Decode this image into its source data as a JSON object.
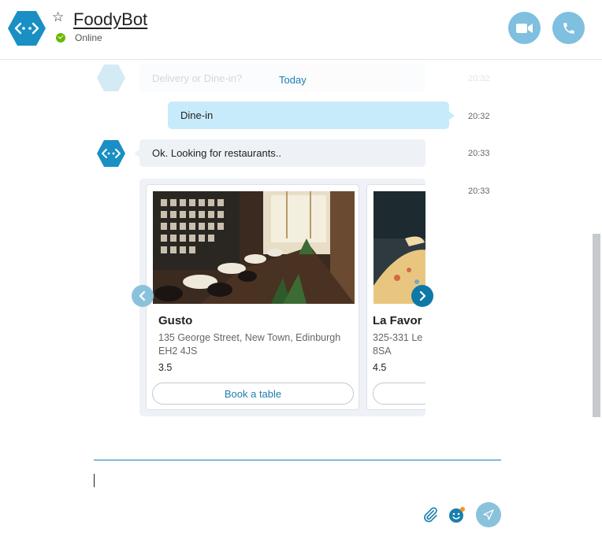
{
  "header": {
    "title": "FoodyBot",
    "status": "Online"
  },
  "chat": {
    "date_separator": "Today",
    "messages": [
      {
        "from": "bot",
        "text": "Delivery or Dine-in?",
        "time": "20:32"
      },
      {
        "from": "me",
        "text": "Dine-in",
        "time": "20:32"
      },
      {
        "from": "bot",
        "text": "Ok. Looking for restaurants..",
        "time": "20:33"
      },
      {
        "from": "bot",
        "type": "carousel",
        "time": "20:33"
      }
    ],
    "carousel": {
      "cards": [
        {
          "name": "Gusto",
          "address": "135 George Street, New Town, Edinburgh EH2 4JS",
          "rating": "3.5",
          "button": "Book a table"
        },
        {
          "name": "La Favor",
          "address": "325-331 Le",
          "address_line2": "8SA",
          "rating": "4.5",
          "button": ""
        }
      ]
    }
  },
  "colors": {
    "accent": "#1a7fae",
    "user_bubble": "#c7ebfa",
    "bot_bubble": "#eef1f6",
    "online": "#6bb700",
    "header_buttons": "#7fbfdf"
  },
  "icons": {
    "avatar": "bot-hexagon-icon",
    "favorite": "star-outline-icon",
    "video": "video-camera-icon",
    "call": "phone-icon",
    "attach": "paperclip-icon",
    "emoji": "smiley-icon",
    "send": "send-arrow-icon",
    "prev": "chevron-left-icon",
    "next": "chevron-right-icon"
  }
}
